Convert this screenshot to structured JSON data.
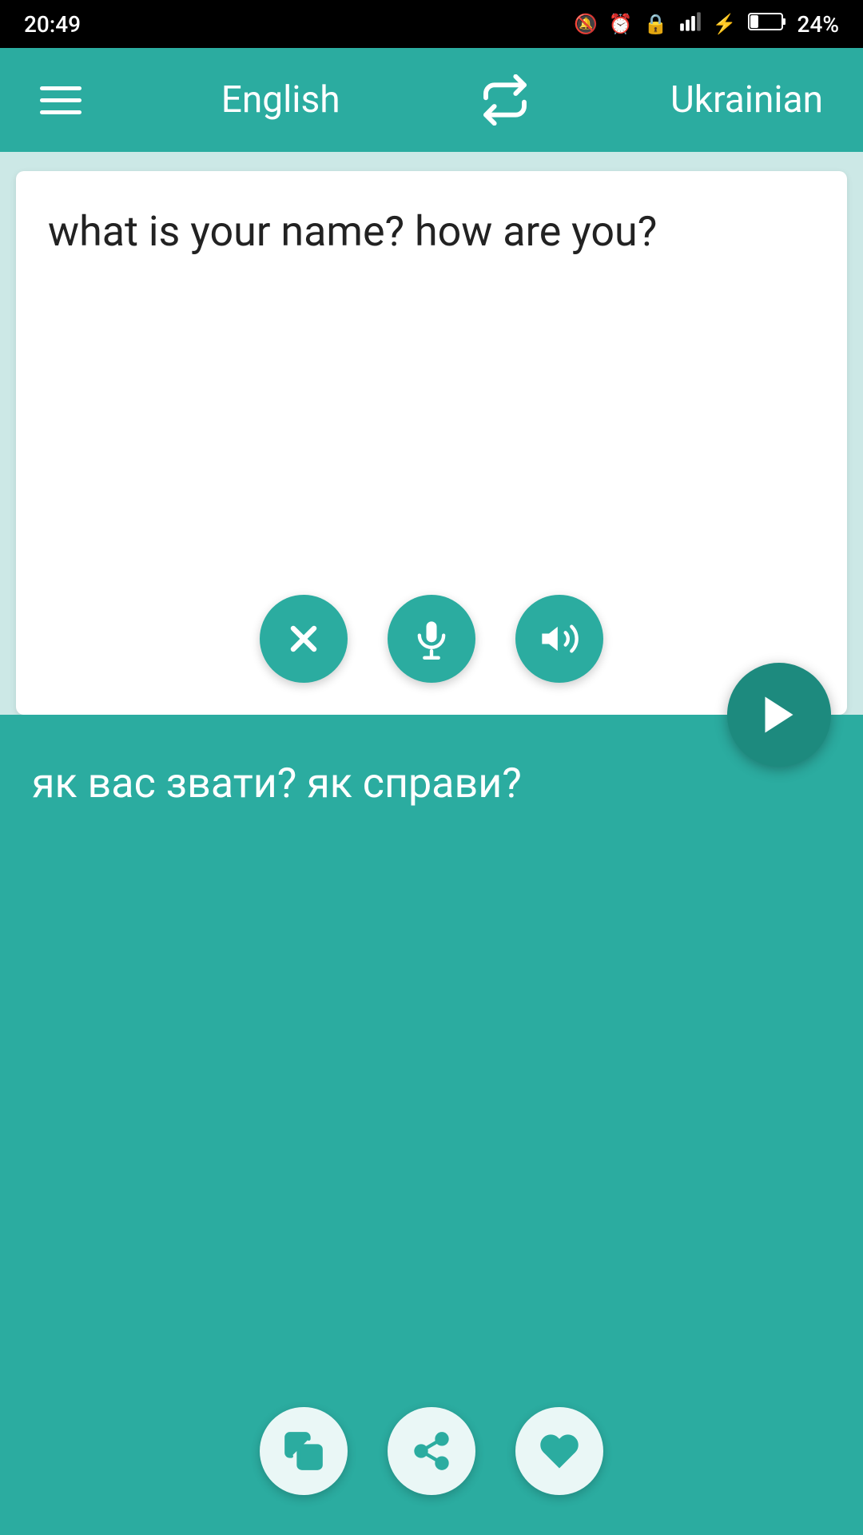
{
  "status_bar": {
    "time": "20:49",
    "battery_percent": "24%"
  },
  "nav": {
    "source_language": "English",
    "target_language": "Ukrainian",
    "menu_icon": "hamburger-menu",
    "swap_icon": "swap-languages"
  },
  "source_panel": {
    "text": "what is your name? how are you?",
    "clear_btn": "clear",
    "mic_btn": "microphone",
    "speaker_btn": "speaker"
  },
  "send_btn": "send-translate",
  "translation_panel": {
    "text": "як вас звати? як справи?",
    "copy_btn": "copy",
    "share_btn": "share",
    "favorite_btn": "favorite"
  }
}
